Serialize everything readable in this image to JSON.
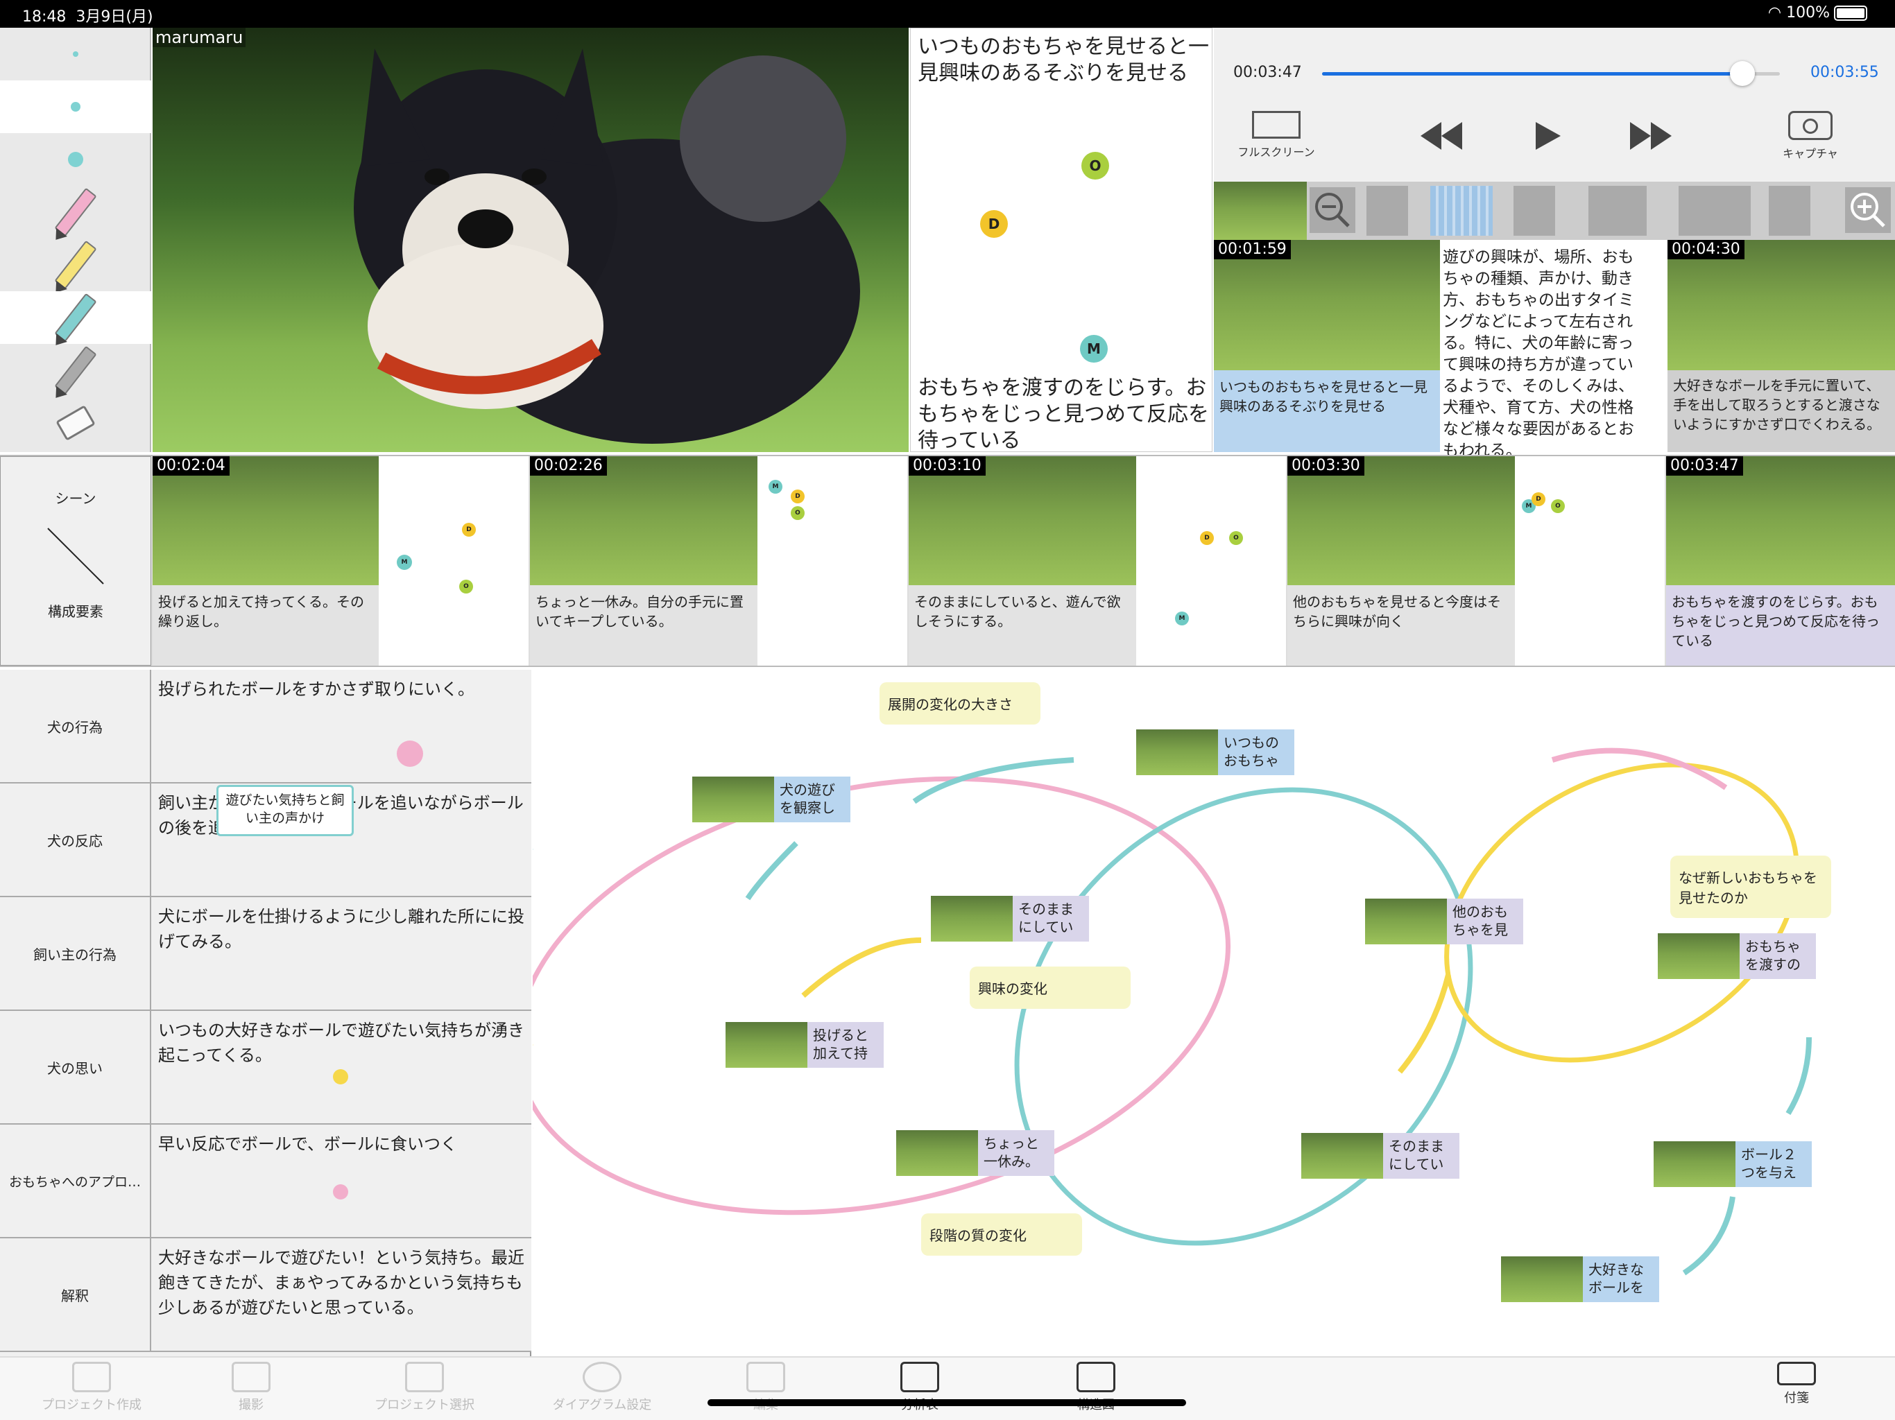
{
  "status": {
    "time": "18:48",
    "date": "3月9日(月)",
    "battery": "100%"
  },
  "video": {
    "label": "marumaru"
  },
  "scene_box": {
    "top_text": "いつものおもちゃを見せると一見興味のあるそぶりを見せる",
    "bottom_text": "おもちゃを渡すのをじらす。おもちゃをじっと見つめて反応を待っている",
    "markers": [
      "O",
      "D",
      "M"
    ]
  },
  "player": {
    "current": "00:03:47",
    "duration": "00:03:55",
    "progress": 0.93,
    "fullscreen": "フルスクリーン",
    "capture": "キャプチャ"
  },
  "side_clips": [
    {
      "time": "00:01:59",
      "caption": "いつものおもちゃを見せると一見興味のあるそぶりを見せる"
    },
    {
      "text": "遊びの興味が、場所、おもちゃの種類、声かけ、動き方、おもちゃの出すタイミングなどによって左右される。特に、犬の年齢に寄って興味の持ち方が違っているようで、そのしくみは、犬種や、育て方、犬の性格など様々な要因があるとおもわれる。"
    },
    {
      "time": "00:04:30",
      "caption": "大好きなボールを手元に置いて、手を出して取ろうとすると渡さないようにすかさず口でくわえる。"
    }
  ],
  "scene_row": {
    "header_top": "シーン",
    "header_bottom": "構成要素",
    "scenes": [
      {
        "time": "00:02:04",
        "caption": "投げると加えて持ってくる。その繰り返し。"
      },
      {
        "time": "00:02:26",
        "caption": "ちょっと一休み。自分の手元に置いてキープしている。"
      },
      {
        "time": "00:03:10",
        "caption": "そのままにしていると、遊んで欲しそうにする。"
      },
      {
        "time": "00:03:30",
        "caption": "他のおもちゃを見せると今度はそちらに興味が向く"
      },
      {
        "time": "00:03:47",
        "caption": "おもちゃを渡すのをじらす。おもちゃをじっと見つめて反応を待っている"
      }
    ]
  },
  "table": {
    "rows": [
      {
        "label": "犬の行為",
        "text": "投げられたボールをすかさず取りにいく。"
      },
      {
        "label": "犬の反応",
        "text": "飼い主が声をかけて、ボールを追いながらボールの後を追う。"
      },
      {
        "label": "飼い主の行為",
        "text": "犬にボールを仕掛けるように少し離れた所にに投げてみる。"
      },
      {
        "label": "犬の思い",
        "text": "いつもの大好きなボールで遊びたい気持ちが湧き起こってくる。"
      },
      {
        "label": "おもちゃへのアプロ…",
        "text": "早い反応でボールで、ボールに食いつく"
      },
      {
        "label": "解釈",
        "text": "大好きなボールで遊びたい！という気持ち。最近飽きてきたが、まぁやってみるかという気持ちも少しあるが遊びたいと思っている。"
      }
    ],
    "tooltip": "遊びたい気持ちと飼い主の声かけ"
  },
  "diagram": {
    "notes": [
      "展開の変化の大きさ",
      "興味の変化",
      "段階の質の変化",
      "なぜ新しいおもちゃを見せたのか"
    ],
    "cards": [
      "犬の遊びを観察し",
      "いつものおもちゃ",
      "そのままにしてい",
      "投げると加えて持",
      "ちょっと一休み。",
      "他のおもちゃを見",
      "そのままにしてい",
      "おもちゃを渡すの",
      "ボール２つを与え",
      "大好きなボールを"
    ]
  },
  "tabbar": {
    "tabs": [
      "プロジェクト作成",
      "撮影",
      "プロジェクト選択",
      "ダイアグラム設定",
      "編集",
      "分析表",
      "構造図"
    ],
    "sticky": "付箋"
  },
  "colors": {
    "accent": "#1a6fe0",
    "pink": "#f2aecb",
    "teal": "#82cfcf",
    "yellow": "#f6d84a",
    "blue_card": "#b8d5ef",
    "purple_card": "#d9d5ea"
  }
}
